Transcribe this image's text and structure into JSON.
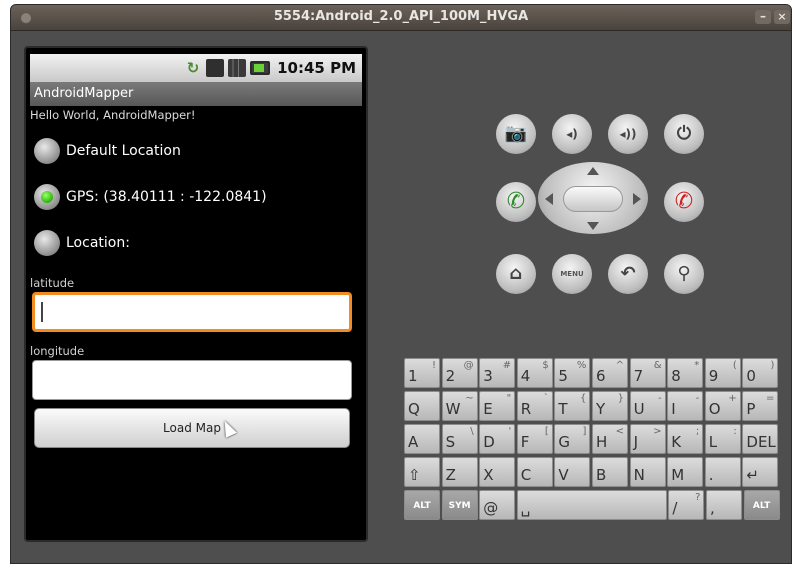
{
  "window": {
    "title": "5554:Android_2.0_API_100M_HVGA",
    "min_label": "–",
    "close_label": "×"
  },
  "statusbar": {
    "time": "10:45 PM",
    "sync_glyph": "↻",
    "icons": [
      "sync-icon",
      "3g-icon",
      "signal-icon",
      "battery-icon"
    ]
  },
  "app": {
    "title": "AndroidMapper",
    "hello": "Hello World, AndroidMapper!",
    "radios": [
      {
        "label": "Default Location",
        "selected": false
      },
      {
        "label": "GPS: (38.40111 : -122.0841)",
        "selected": true
      },
      {
        "label": "Location:",
        "selected": false
      }
    ],
    "latitude_label": "latitude",
    "latitude_value": "",
    "longitude_label": "longitude",
    "longitude_value": "",
    "load_button": "Load Map"
  },
  "controls": {
    "camera": "📷",
    "vol_down": "◂)",
    "vol_up": "◂))",
    "power": "⏻",
    "call": "✆",
    "end_call": "✆",
    "home": "⌂",
    "menu": "MENU",
    "back": "↶",
    "search": "⚲"
  },
  "keyboard": {
    "row1": [
      [
        "1",
        "!"
      ],
      [
        "2",
        "@"
      ],
      [
        "3",
        "#"
      ],
      [
        "4",
        "$"
      ],
      [
        "5",
        "%"
      ],
      [
        "6",
        "^"
      ],
      [
        "7",
        "&"
      ],
      [
        "8",
        "*"
      ],
      [
        "9",
        "("
      ],
      [
        "0",
        ")"
      ]
    ],
    "row2": [
      [
        "Q",
        ""
      ],
      [
        "W",
        "~"
      ],
      [
        "E",
        "\""
      ],
      [
        "R",
        "`"
      ],
      [
        "T",
        "{"
      ],
      [
        "Y",
        "}"
      ],
      [
        "U",
        "-"
      ],
      [
        "I",
        "-"
      ],
      [
        "O",
        "+"
      ],
      [
        "P",
        "="
      ]
    ],
    "row3": [
      [
        "A",
        ""
      ],
      [
        "S",
        "\\"
      ],
      [
        "D",
        "'"
      ],
      [
        "F",
        "["
      ],
      [
        "G",
        "]"
      ],
      [
        "H",
        "<"
      ],
      [
        "J",
        ">"
      ],
      [
        "K",
        ";"
      ],
      [
        "L",
        ":"
      ],
      [
        "DEL",
        ""
      ]
    ],
    "row4": [
      [
        "⇧",
        ""
      ],
      [
        "Z",
        ""
      ],
      [
        "X",
        ""
      ],
      [
        "C",
        ""
      ],
      [
        "V",
        ""
      ],
      [
        "B",
        ""
      ],
      [
        "N",
        ""
      ],
      [
        "M",
        ""
      ],
      [
        ".",
        ""
      ],
      [
        "↵",
        ""
      ]
    ],
    "row5": {
      "alt": "ALT",
      "sym": "SYM",
      "at": "@",
      "space": "␣",
      "slash": "/",
      "question": "?",
      "comma": ",",
      "alt2": "ALT"
    }
  }
}
